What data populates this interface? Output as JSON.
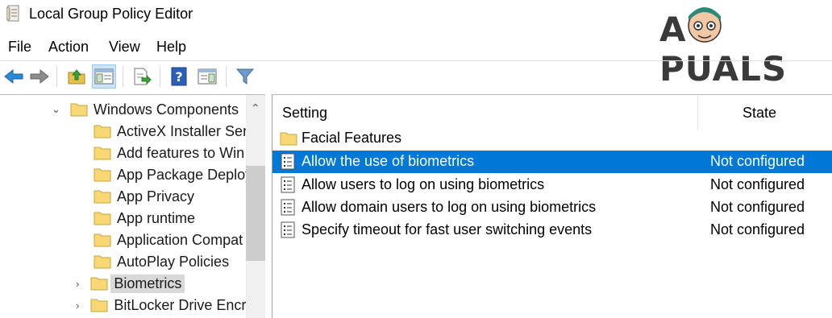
{
  "window": {
    "title": "Local Group Policy Editor"
  },
  "watermark": {
    "text": "APPUALS"
  },
  "menu": [
    "File",
    "Action",
    "View",
    "Help"
  ],
  "toolbar": {
    "buttons": [
      "back-arrow-icon",
      "forward-arrow-icon",
      "up-folder-icon",
      "show-hide-tree-icon",
      "export-list-icon",
      "help-icon",
      "properties-icon",
      "filter-icon"
    ]
  },
  "tree": {
    "parent": "Windows Components",
    "children": [
      "ActiveX Installer Serv",
      "Add features to Win",
      "App Package Deploy",
      "App Privacy",
      "App runtime",
      "Application Compat",
      "AutoPlay Policies",
      "Biometrics",
      "BitLocker Drive Encry"
    ],
    "selected": "Biometrics"
  },
  "list": {
    "headers": {
      "setting": "Setting",
      "state": "State"
    },
    "folder": "Facial Features",
    "rows": [
      {
        "name": "Allow the use of biometrics",
        "state": "Not configured"
      },
      {
        "name": "Allow users to log on using biometrics",
        "state": "Not configured"
      },
      {
        "name": "Allow domain users to log on using biometrics",
        "state": "Not configured"
      },
      {
        "name": "Specify timeout for fast user switching events",
        "state": "Not configured"
      }
    ]
  },
  "colors": {
    "selection": "#0078d7",
    "tree_selection": "#d9d9d9",
    "folder": "#f8d775"
  }
}
